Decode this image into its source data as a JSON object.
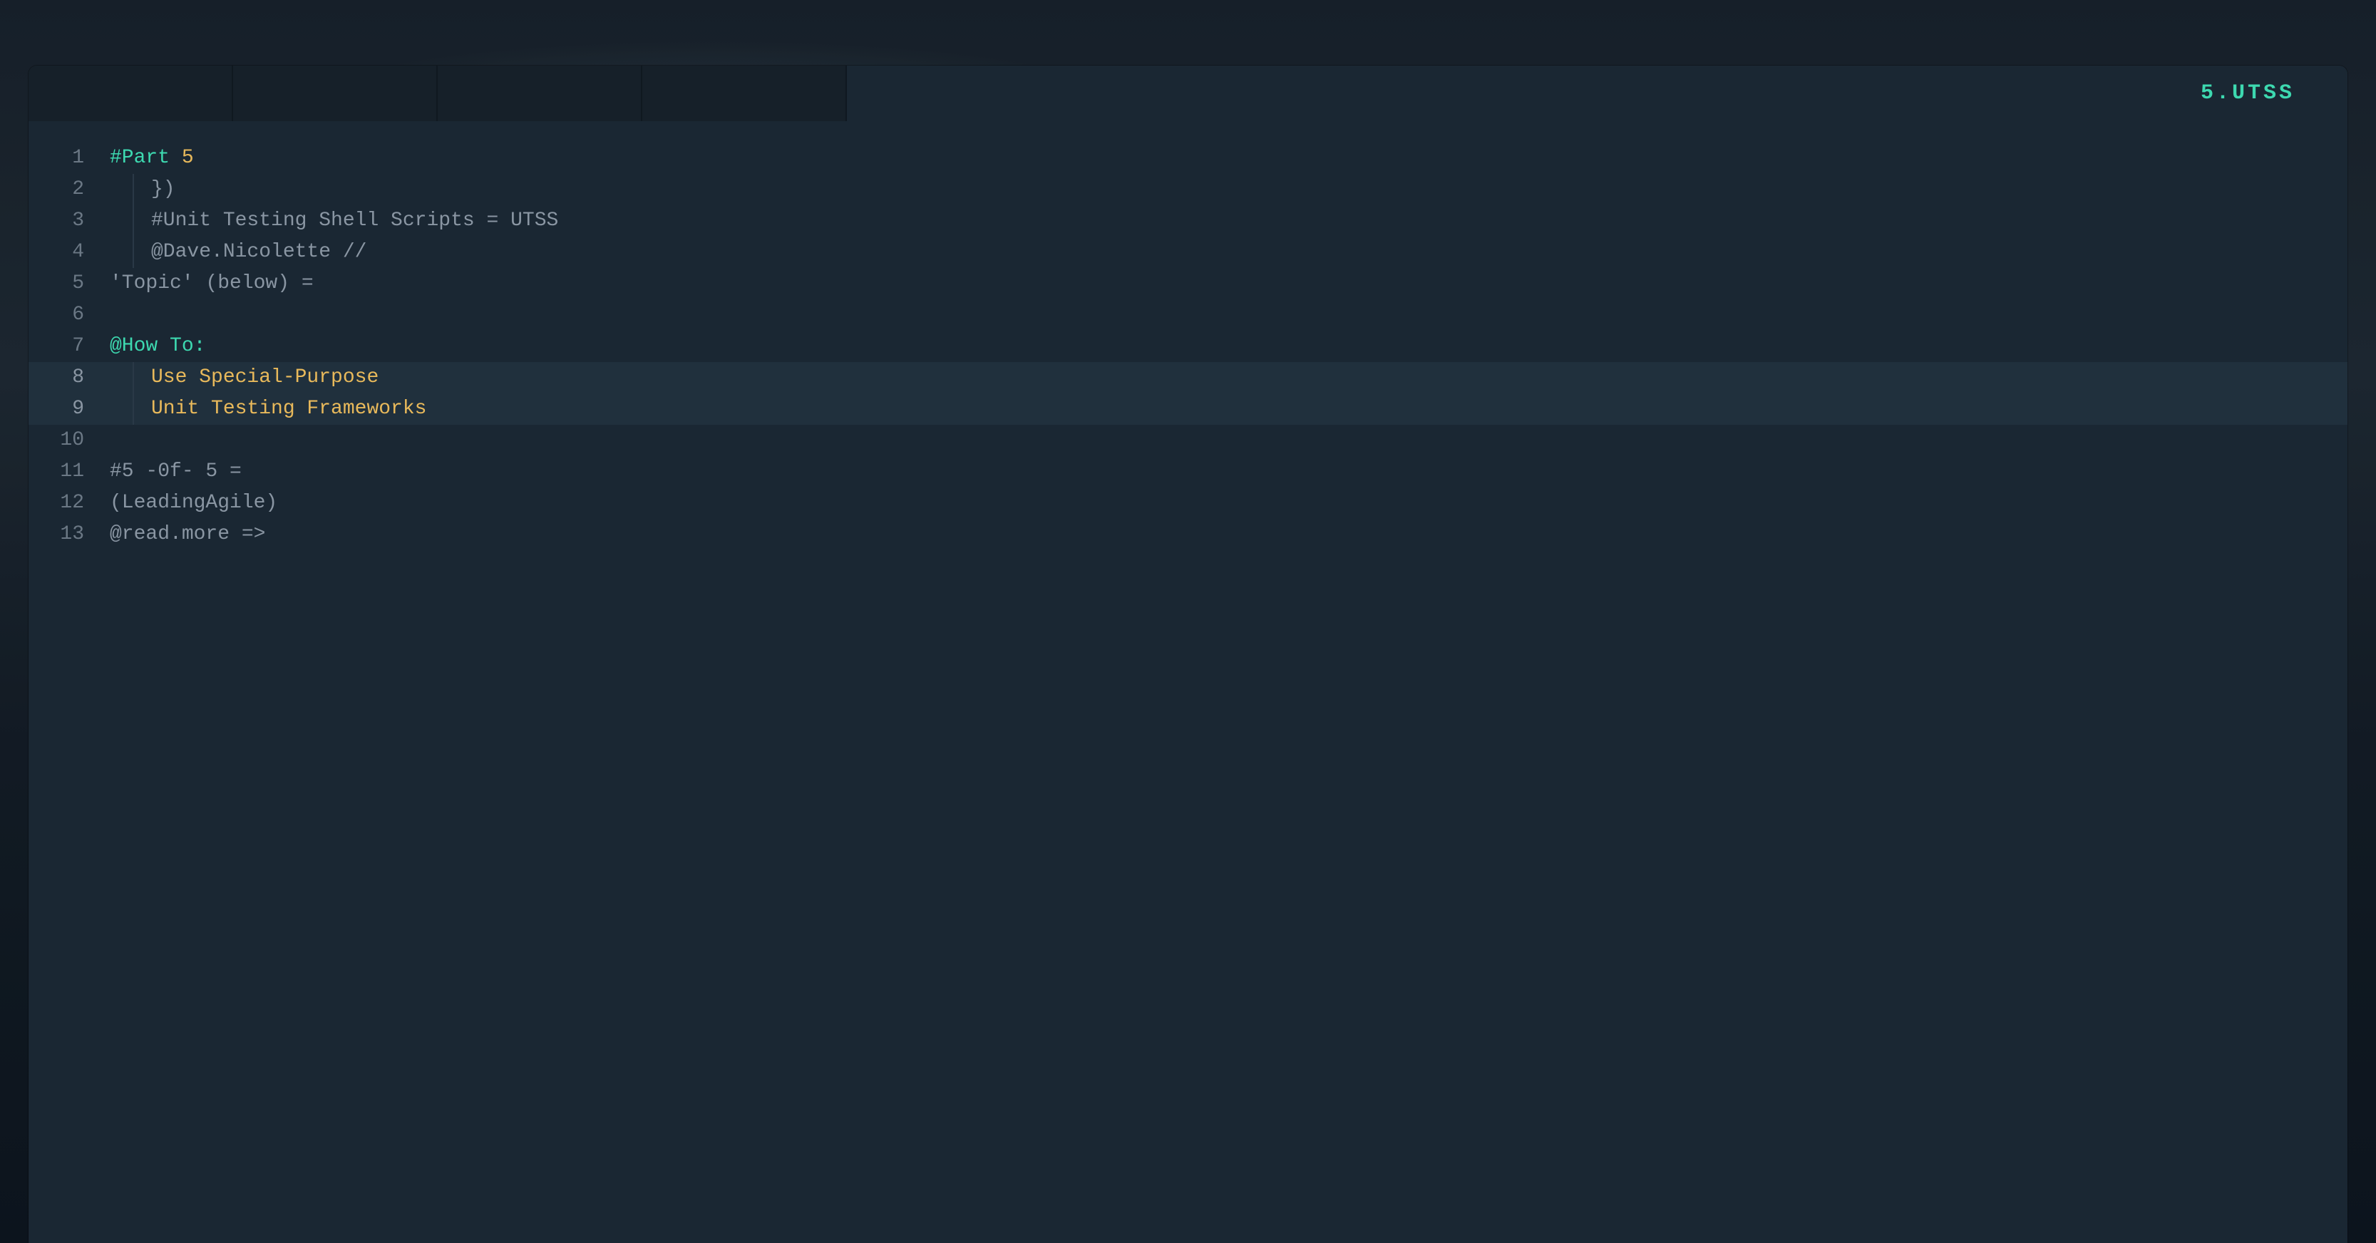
{
  "tabs": {
    "count": 5,
    "activeIndex": 4,
    "activeLabel": "5.UTSS"
  },
  "colors": {
    "accent": "#3dd9b0",
    "gold": "#e8b95b",
    "bg": "#1a2733",
    "bgTab": "#162029",
    "gutter": "#6b7885"
  },
  "lines": [
    {
      "n": "1",
      "guide": false,
      "hl": false,
      "tokens": [
        {
          "cls": "tok-hash",
          "t": "#Part "
        },
        {
          "cls": "tok-num",
          "t": "5"
        }
      ]
    },
    {
      "n": "2",
      "guide": true,
      "hl": false,
      "tokens": [
        {
          "cls": "tok-default",
          "t": "})"
        }
      ]
    },
    {
      "n": "3",
      "guide": true,
      "hl": false,
      "tokens": [
        {
          "cls": "tok-default",
          "t": "#Unit Testing Shell Scripts = UTSS"
        }
      ]
    },
    {
      "n": "4",
      "guide": true,
      "hl": false,
      "tokens": [
        {
          "cls": "tok-default",
          "t": "@Dave.Nicolette //"
        }
      ]
    },
    {
      "n": "5",
      "guide": false,
      "hl": false,
      "tokens": [
        {
          "cls": "tok-default",
          "t": "'Topic' (below) ="
        }
      ]
    },
    {
      "n": "6",
      "guide": false,
      "hl": false,
      "tokens": [
        {
          "cls": "tok-default",
          "t": ""
        }
      ]
    },
    {
      "n": "7",
      "guide": false,
      "hl": false,
      "tokens": [
        {
          "cls": "tok-at",
          "t": "@How To:"
        }
      ]
    },
    {
      "n": "8",
      "guide": true,
      "hl": true,
      "tokens": [
        {
          "cls": "tok-gold",
          "t": "Use Special-Purpose"
        }
      ]
    },
    {
      "n": "9",
      "guide": true,
      "hl": true,
      "tokens": [
        {
          "cls": "tok-gold",
          "t": "Unit Testing Frameworks"
        }
      ]
    },
    {
      "n": "10",
      "guide": false,
      "hl": false,
      "tokens": [
        {
          "cls": "tok-default",
          "t": ""
        }
      ]
    },
    {
      "n": "11",
      "guide": false,
      "hl": false,
      "tokens": [
        {
          "cls": "tok-default",
          "t": "#5 -0f- 5 ="
        }
      ]
    },
    {
      "n": "12",
      "guide": false,
      "hl": false,
      "tokens": [
        {
          "cls": "tok-default",
          "t": "(LeadingAgile)"
        }
      ]
    },
    {
      "n": "13",
      "guide": false,
      "hl": false,
      "tokens": [
        {
          "cls": "tok-default",
          "t": "@read.more =>"
        }
      ]
    }
  ]
}
